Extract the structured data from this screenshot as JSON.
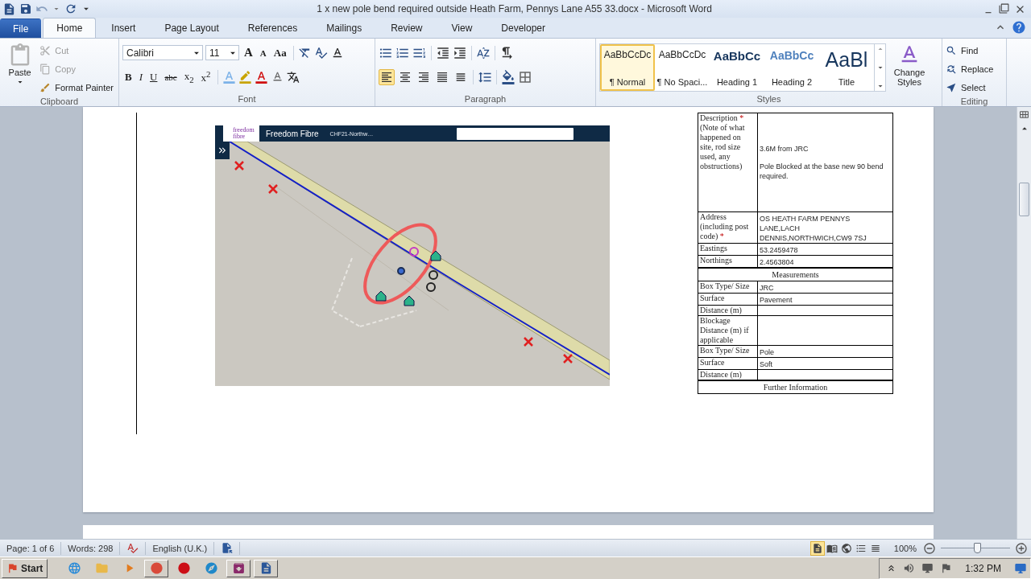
{
  "window": {
    "title": "1 x new pole bend required outside Heath Farm, Pennys Lane A55 33.docx - Microsoft Word"
  },
  "tabs": [
    {
      "label": "File",
      "kind": "file",
      "selected": false
    },
    {
      "label": "Home",
      "kind": "tab",
      "selected": true
    },
    {
      "label": "Insert",
      "kind": "tab",
      "selected": false
    },
    {
      "label": "Page Layout",
      "kind": "tab",
      "selected": false
    },
    {
      "label": "References",
      "kind": "tab",
      "selected": false
    },
    {
      "label": "Mailings",
      "kind": "tab",
      "selected": false
    },
    {
      "label": "Review",
      "kind": "tab",
      "selected": false
    },
    {
      "label": "View",
      "kind": "tab",
      "selected": false
    },
    {
      "label": "Developer",
      "kind": "tab",
      "selected": false
    }
  ],
  "clipboard": {
    "label": "Clipboard",
    "paste": "Paste",
    "commands": [
      {
        "label": "Cut",
        "kind": "cut",
        "disabled": true
      },
      {
        "label": "Copy",
        "kind": "copy",
        "disabled": true
      },
      {
        "label": "Format Painter",
        "kind": "painter",
        "disabled": false
      }
    ]
  },
  "font": {
    "label": "Font",
    "name": "Calibri",
    "size": "11",
    "size_buttons": [
      {
        "label": "A",
        "kind": "grow"
      },
      {
        "label": "A",
        "kind": "shrink"
      },
      {
        "label": "Aa",
        "kind": "case"
      }
    ],
    "format_buttons": [
      {
        "label": "B",
        "kind": "bold"
      },
      {
        "label": "I",
        "kind": "italic"
      },
      {
        "label": "U",
        "kind": "underline"
      },
      {
        "label": "abc",
        "kind": "strike"
      },
      {
        "label": "x$_{2}$",
        "kind": "sub"
      },
      {
        "label": "x$^{2}$",
        "kind": "super"
      }
    ]
  },
  "paragraph": {
    "label": "Paragraph",
    "align_buttons": [
      {
        "kind": "left",
        "selected": true
      },
      {
        "kind": "center",
        "selected": false
      },
      {
        "kind": "right",
        "selected": false
      },
      {
        "kind": "justify",
        "selected": false
      },
      {
        "kind": "distributed",
        "selected": false
      }
    ]
  },
  "styles": {
    "label": "Styles",
    "items": [
      {
        "preview": "AaBbCcDc",
        "name": "¶ Normal",
        "kind": "normal",
        "selected": true
      },
      {
        "preview": "AaBbCcDc",
        "name": "¶ No Spaci...",
        "kind": "normal",
        "selected": false
      },
      {
        "preview": "AaBbCc",
        "name": "Heading 1",
        "kind": "heading1",
        "selected": false
      },
      {
        "preview": "AaBbCc",
        "name": "Heading 2",
        "kind": "heading2",
        "selected": false
      },
      {
        "preview": "AaBl",
        "name": "Title",
        "kind": "title",
        "selected": false
      }
    ],
    "change_styles": "Change Styles"
  },
  "editing": {
    "label": "Editing",
    "commands": [
      {
        "label": "Find",
        "kind": "find"
      },
      {
        "label": "Replace",
        "kind": "replace"
      },
      {
        "label": "Select",
        "kind": "select"
      }
    ]
  },
  "document": {
    "map_screenshot": {
      "logo": [
        "freedom",
        "fibre"
      ],
      "app_title": "Freedom Fibre",
      "project": "CHF21-Northw…",
      "map": {
        "kind": "picture"
      }
    },
    "form_table": {
      "rows": [
        {
          "kind": "field",
          "label": "Description",
          "required": "*",
          "note": "(Note of what happened on site, rod size used, any obstructions)",
          "value": [
            "3.6M from JRC",
            "Pole Blocked at the base new 90 bend required."
          ]
        },
        {
          "kind": "field",
          "label": "Address (including post code)",
          "required": "*",
          "value": [
            "OS HEATH FARM PENNYS LANE,LACH DENNIS,NORTHWICH,CW9 7SJ"
          ]
        },
        {
          "kind": "field",
          "label": "Eastings",
          "value": [
            "53.2459478"
          ]
        },
        {
          "kind": "field",
          "label": "Northings",
          "value": [
            "2.4563804"
          ]
        },
        {
          "kind": "heading",
          "label": "Measurements"
        },
        {
          "kind": "field",
          "label": "Box Type/ Size",
          "value": [
            "JRC"
          ]
        },
        {
          "kind": "field",
          "label": "Surface",
          "value": [
            "Pavement"
          ]
        },
        {
          "kind": "field",
          "label": "Distance (m)"
        },
        {
          "kind": "field",
          "label": "Blockage Distance (m) if applicable"
        },
        {
          "kind": "field",
          "label": "Box Type/ Size",
          "value": [
            "Pole"
          ]
        },
        {
          "kind": "field",
          "label": "Surface",
          "value": [
            "Soft"
          ]
        },
        {
          "kind": "field",
          "label": "Distance (m)"
        },
        {
          "kind": "heading",
          "label": "Further Information"
        }
      ]
    }
  },
  "status_bar": {
    "page": "Page: 1 of 6",
    "words": "Words: 298",
    "language": "English (U.K.)",
    "view_buttons": [
      {
        "kind": "print",
        "selected": true
      },
      {
        "kind": "reading",
        "selected": false
      },
      {
        "kind": "web",
        "selected": false
      },
      {
        "kind": "outline",
        "selected": false
      },
      {
        "kind": "draft",
        "selected": false
      }
    ],
    "zoom": "100%",
    "zoom_slider": {
      "level": 0.52
    }
  },
  "taskbar": {
    "start": "Start",
    "apps": [
      {
        "kind": "ie",
        "running": false
      },
      {
        "kind": "folder",
        "running": false
      },
      {
        "kind": "media",
        "running": false
      },
      {
        "kind": "chrome",
        "running": true
      },
      {
        "kind": "opera",
        "running": false
      },
      {
        "kind": "edge",
        "running": false
      },
      {
        "kind": "archive",
        "running": true
      },
      {
        "kind": "word",
        "running": true
      }
    ],
    "time": "1:32 PM"
  }
}
